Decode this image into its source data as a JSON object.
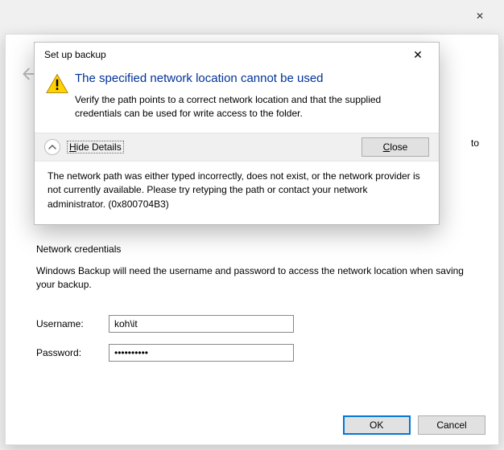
{
  "ghost": {
    "close": "✕"
  },
  "wizard": {
    "truncated_right_text": "to",
    "credentials": {
      "title": "Network credentials",
      "desc": "Windows Backup will need the username and password to access the network location when saving your backup.",
      "username_label": "Username:",
      "username_value": "koh\\it",
      "password_label": "Password:",
      "password_value": "••••••••••"
    },
    "ok": "OK",
    "cancel": "Cancel"
  },
  "dialog": {
    "title": "Set up backup",
    "close_x": "✕",
    "heading": "The specified network location cannot be used",
    "message": "Verify the path points to a correct network location and that the supplied credentials can be used for write access to the folder.",
    "toggle_prefix": "H",
    "toggle_rest": "ide Details",
    "close_btn_prefix": "C",
    "close_btn_rest": "lose",
    "details": "The network path was either typed incorrectly, does not exist, or the network provider is not currently available. Please try retyping the path or contact your network administrator. (0x800704B3)"
  }
}
